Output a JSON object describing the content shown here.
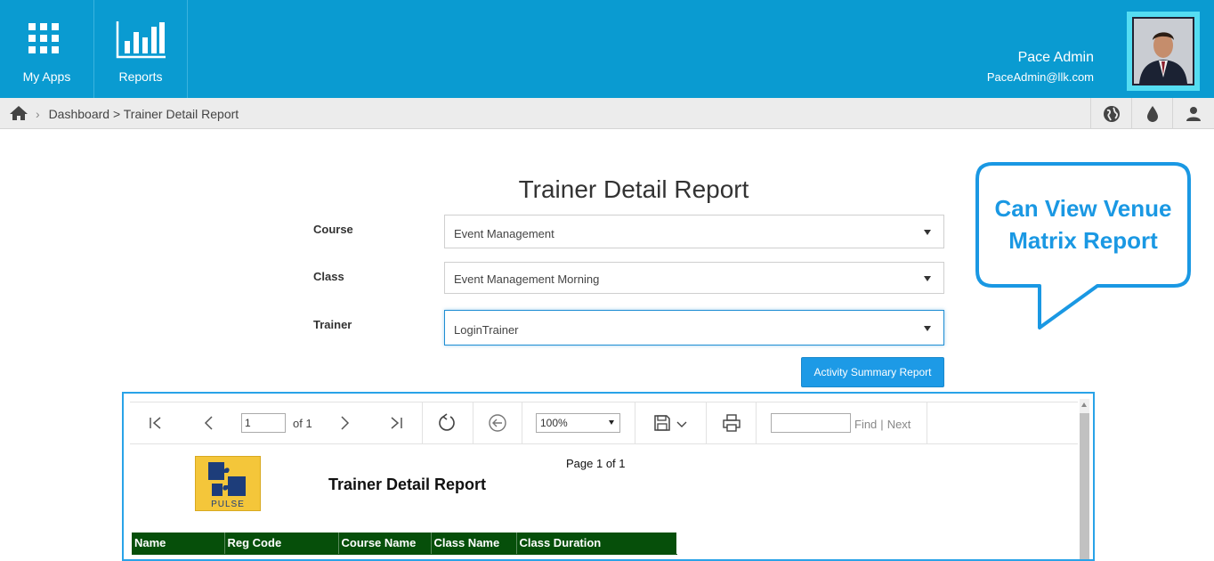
{
  "header": {
    "apps": [
      {
        "label": "My Apps",
        "icon": "grid-icon"
      },
      {
        "label": "Reports",
        "icon": "bar-chart-icon"
      }
    ],
    "user": {
      "name": "Pace Admin",
      "email": "PaceAdmin@llk.com"
    }
  },
  "breadcrumb": {
    "home_icon": "home-icon",
    "path": "Dashboard > Trainer Detail Report",
    "tools": [
      "globe-icon",
      "drop-icon",
      "user-icon"
    ]
  },
  "form": {
    "title": "Trainer Detail Report",
    "fields": [
      {
        "label": "Course",
        "value": "Event Management"
      },
      {
        "label": "Class",
        "value": "Event Management Morning"
      },
      {
        "label": "Trainer",
        "value": "LoginTrainer"
      }
    ],
    "summary_button": "Activity Summary Report"
  },
  "callout": {
    "line1": "Can View Venue",
    "line2": "Matrix Report"
  },
  "viewer": {
    "page_value": "1",
    "of_label": "of 1",
    "zoom": "100%",
    "find": "Find",
    "next": "Next",
    "separator": "|",
    "page_of": "Page 1 of 1",
    "report_title": "Trainer Detail Report",
    "logo_text": "PULSE",
    "columns": [
      "Name",
      "Reg Code",
      "Course Name",
      "Class Name",
      "Class Duration"
    ]
  },
  "colors": {
    "header": "#0a9bd1",
    "accent": "#1d9ae6",
    "table_header": "#064f0a"
  }
}
